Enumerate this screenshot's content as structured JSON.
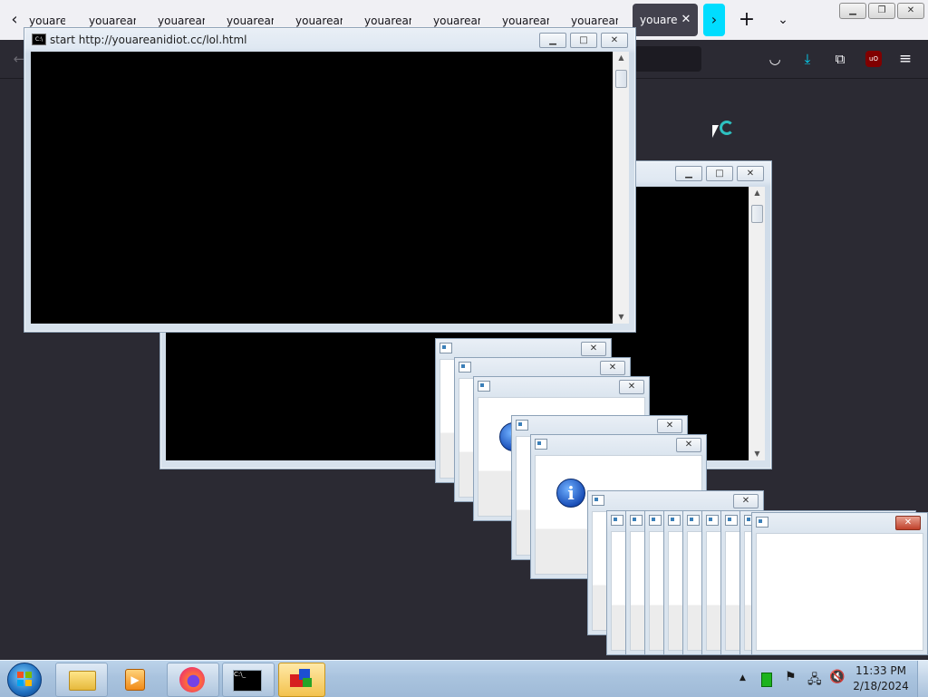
{
  "browser": {
    "bg_tabs": [
      "youareani",
      "youareani",
      "youareani",
      "youareani",
      "youareani",
      "youareani",
      "youareani",
      "youareani",
      "youareani"
    ],
    "active_tab": {
      "title": "youareanidiot",
      "close": "✕"
    },
    "icons": [
      "back-icon",
      "new-tab-icon",
      "list-all-tabs-icon",
      "pocket-icon",
      "downloads-icon",
      "extensions-icon",
      "ublock-icon",
      "menu-icon"
    ]
  },
  "cmd_window_front": {
    "title": "start  http://youareanidiot.cc/lol.html"
  },
  "cmd_window_back": {
    "title": ""
  },
  "taskbar": {
    "time": "11:33 PM",
    "date": "2/18/2024",
    "apps": [
      "start-orb",
      "file-explorer",
      "media-player",
      "firefox",
      "command-prompt",
      "virtual-box-app"
    ]
  },
  "colors": {
    "accent_cyan": "#00ddff",
    "console_black": "#000000",
    "desktop_bg": "#2b2a33"
  }
}
